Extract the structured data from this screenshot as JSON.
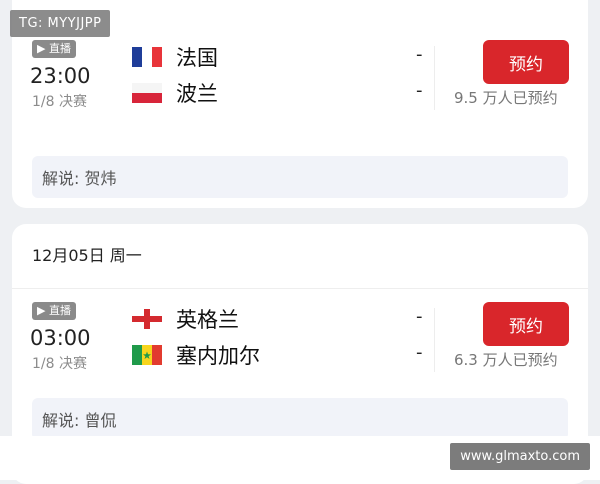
{
  "watermark_top": "TG: MYYJJPP",
  "watermark_bottom": "www.glmaxto.com",
  "matches": [
    {
      "live_label": "▶ 直播",
      "time": "23:00",
      "round": "1/8 决赛",
      "team1": "法国",
      "team2": "波兰",
      "score1": "-",
      "score2": "-",
      "reserve_label": "预约",
      "reserve_count": "9.5 万人已预约",
      "commentary": "解说: 贺炜"
    },
    {
      "date_header": "12月05日 周一",
      "live_label": "▶ 直播",
      "time": "03:00",
      "round": "1/8 决赛",
      "team1": "英格兰",
      "team2": "塞内加尔",
      "score1": "-",
      "score2": "-",
      "reserve_label": "预约",
      "reserve_count": "6.3 万人已预约",
      "commentary": "解说: 曾侃"
    }
  ],
  "colors": {
    "reserve_button": "#d9262b",
    "background": "#eef0f3",
    "commentary_bg": "#f1f3f9"
  },
  "icons": {
    "france": "france-flag-icon",
    "poland": "poland-flag-icon",
    "england": "england-flag-icon",
    "senegal": "senegal-flag-icon"
  }
}
